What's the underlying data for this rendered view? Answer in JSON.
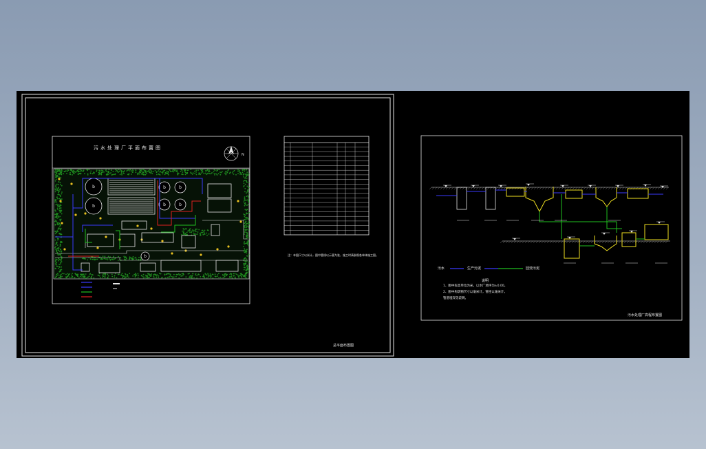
{
  "colors": {
    "background_top": "#8a9bb2",
    "viewport": "#000000",
    "line_white": "#e6e6e6",
    "water_pipe": "#3a3aff",
    "sludge_pipe": "#e02020",
    "return_pipe": "#20c020",
    "tank_yellow": "#f0e020",
    "tree_green": "#1e8a1e",
    "ground_hatch": "#9a9a9a"
  },
  "sheet1": {
    "title": "总平面布置图",
    "site_title": "污水处理厂平面布置图",
    "north_label": "N",
    "note_line": "注：本图尺寸以米计，图中管线以示意为准，施工时请参照各单体施工图。",
    "legend_rows": 4,
    "table_rows": 20
  },
  "sheet2": {
    "title": "污水处理厂高程布置图",
    "notes_heading": "说明",
    "notes": [
      "1、图中标高单位为米，以水厂地坪为±0.00。",
      "2、图中构筑物尺寸以毫米计，管径以毫米计，",
      "   管道埋深见说明。"
    ],
    "legend_items": [
      {
        "label": "污水",
        "color": "#3a3aff"
      },
      {
        "label": "生产污泥",
        "color": "#3a3aff"
      },
      {
        "label": "回流污泥",
        "color": "#20c020"
      }
    ]
  }
}
